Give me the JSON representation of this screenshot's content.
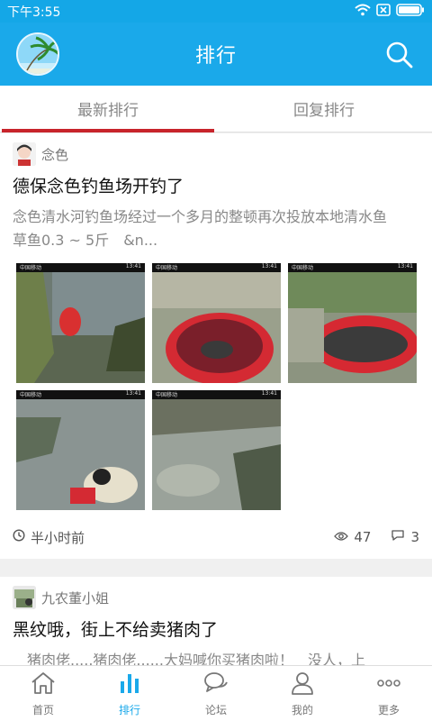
{
  "status_bar": {
    "time": "下午3:55"
  },
  "app_bar": {
    "title": "排行"
  },
  "tabs": [
    {
      "label": "最新排行",
      "active": true
    },
    {
      "label": "回复排行",
      "active": false
    }
  ],
  "posts": [
    {
      "author": "念色",
      "title": "德保念色钓鱼场开钓了",
      "excerpt": "念色清水河钓鱼场经过一个多月的整顿再次投放本地清水鱼　 草鱼0.3 ~ 5斤　&n...",
      "time": "半小时前",
      "views": "47",
      "comments": "3",
      "images": [
        {
          "carrier": "中国移动",
          "clock": "13:41"
        },
        {
          "carrier": "中国移动",
          "clock": "13:41"
        },
        {
          "carrier": "中国移动",
          "clock": "13:41"
        },
        {
          "carrier": "中国移动",
          "clock": "13:41"
        },
        {
          "carrier": "中国移动",
          "clock": "13:41"
        }
      ]
    },
    {
      "author": "九农董小姐",
      "title": "黑纹哦，街上不给卖猪肉了",
      "excerpt": "　猪肉佬.....猪肉佬......大妈喊你买猪肉啦！　没人，上"
    }
  ],
  "bottom_nav": [
    {
      "label": "首页",
      "icon": "home-icon",
      "active": false
    },
    {
      "label": "排行",
      "icon": "ranking-icon",
      "active": true
    },
    {
      "label": "论坛",
      "icon": "forum-icon",
      "active": false
    },
    {
      "label": "我的",
      "icon": "profile-icon",
      "active": false
    },
    {
      "label": "更多",
      "icon": "more-icon",
      "active": false
    }
  ],
  "colors": {
    "primary": "#1aa9ea",
    "status_bar": "#14a7e7",
    "tab_indicator": "#c8242b",
    "text_dark": "#111111",
    "text_muted": "#888888"
  }
}
